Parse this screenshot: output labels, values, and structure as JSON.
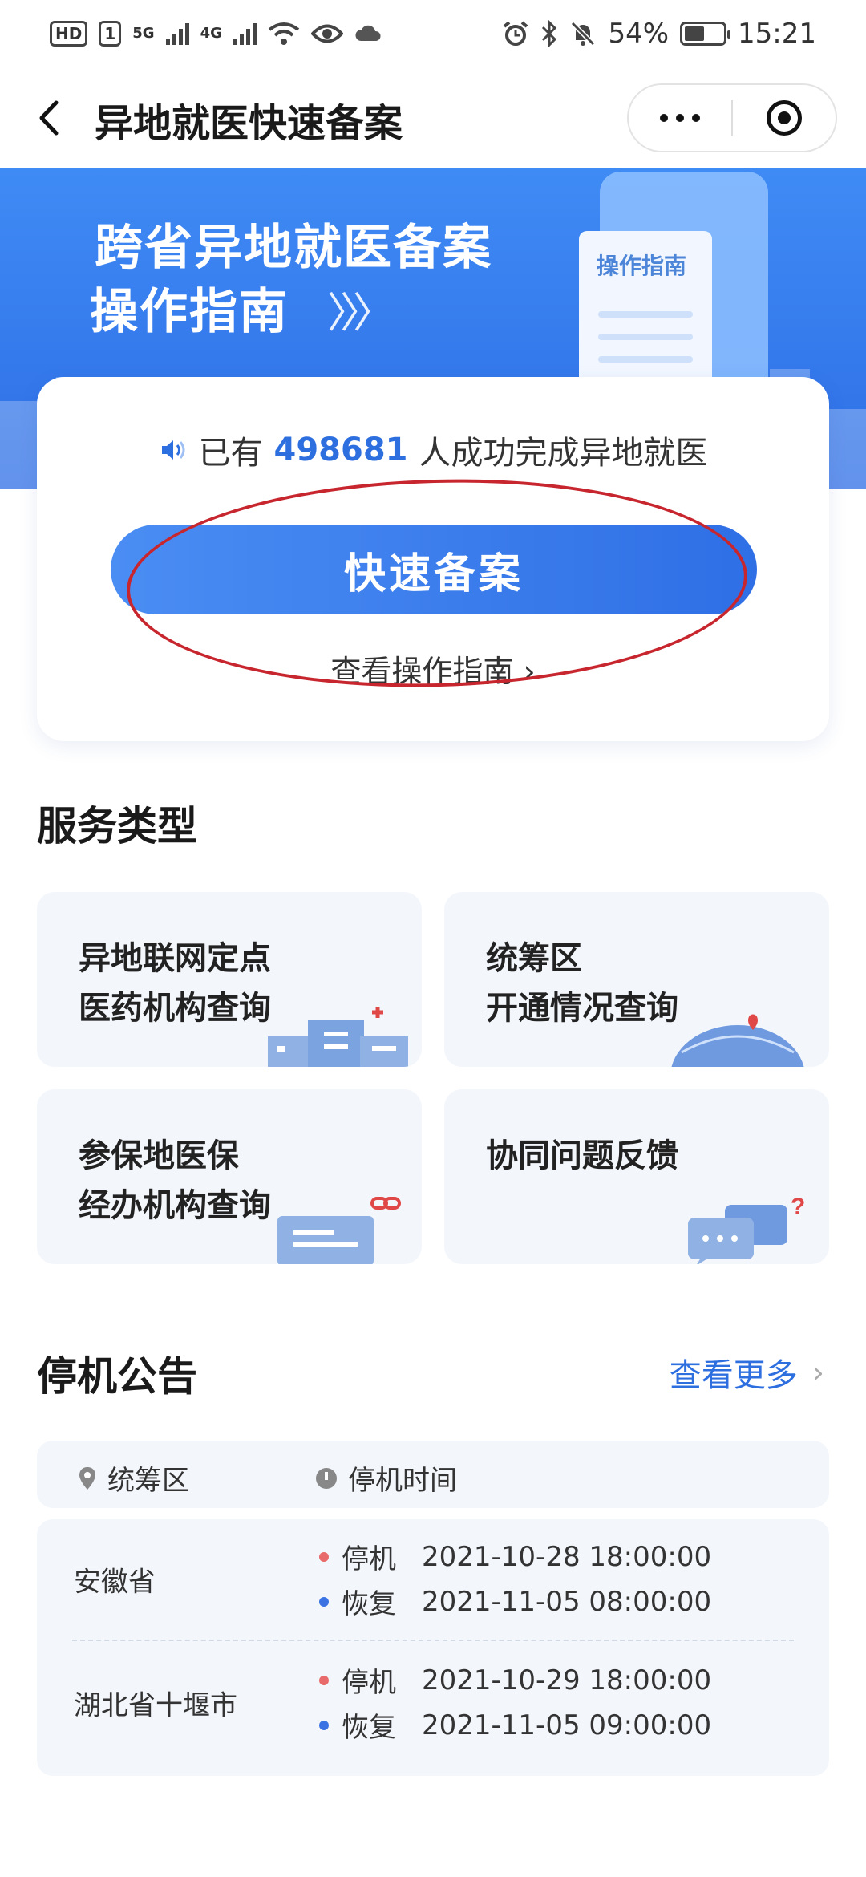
{
  "status_bar": {
    "left_badge_1": "HD",
    "left_badge_2": "1",
    "net_1": "5G",
    "net_2": "4G",
    "battery_percent": "54%",
    "time": "15:21"
  },
  "header": {
    "title": "异地就医快速备案"
  },
  "banner": {
    "line1": "跨省异地就医备案",
    "line2": "操作指南",
    "arrows": "〉〉〉",
    "doc_label": "操作指南"
  },
  "card": {
    "notice_prefix": "已有",
    "count": "498681",
    "notice_suffix": "人成功完成异地就医",
    "primary_button": "快速备案",
    "guide_link": "查看操作指南 ›"
  },
  "services": {
    "section_title": "服务类型",
    "items": [
      {
        "line1": "异地联网定点",
        "line2": "医药机构查询",
        "icon": "hospital-icon"
      },
      {
        "line1": "统筹区",
        "line2": "开通情况查询",
        "icon": "globe-pin-icon"
      },
      {
        "line1": "参保地医保",
        "line2": "经办机构查询",
        "icon": "card-link-icon"
      },
      {
        "line1": "协同问题反馈",
        "line2": "",
        "icon": "chat-question-icon"
      }
    ]
  },
  "announcement": {
    "section_title": "停机公告",
    "more_link": "查看更多",
    "col_region": "统筹区",
    "col_time": "停机时间",
    "rows": [
      {
        "region": "安徽省",
        "stop_label": "停机",
        "stop_time": "2021-10-28 18:00:00",
        "resume_label": "恢复",
        "resume_time": "2021-11-05 08:00:00"
      },
      {
        "region": "湖北省十堰市",
        "stop_label": "停机",
        "stop_time": "2021-10-29 18:00:00",
        "resume_label": "恢复",
        "resume_time": "2021-11-05 09:00:00"
      }
    ]
  },
  "colors": {
    "primary": "#2e6fe0",
    "stop_dot": "#e86a6a",
    "resume_dot": "#3b74e2",
    "annotation_circle": "#c8262e"
  }
}
